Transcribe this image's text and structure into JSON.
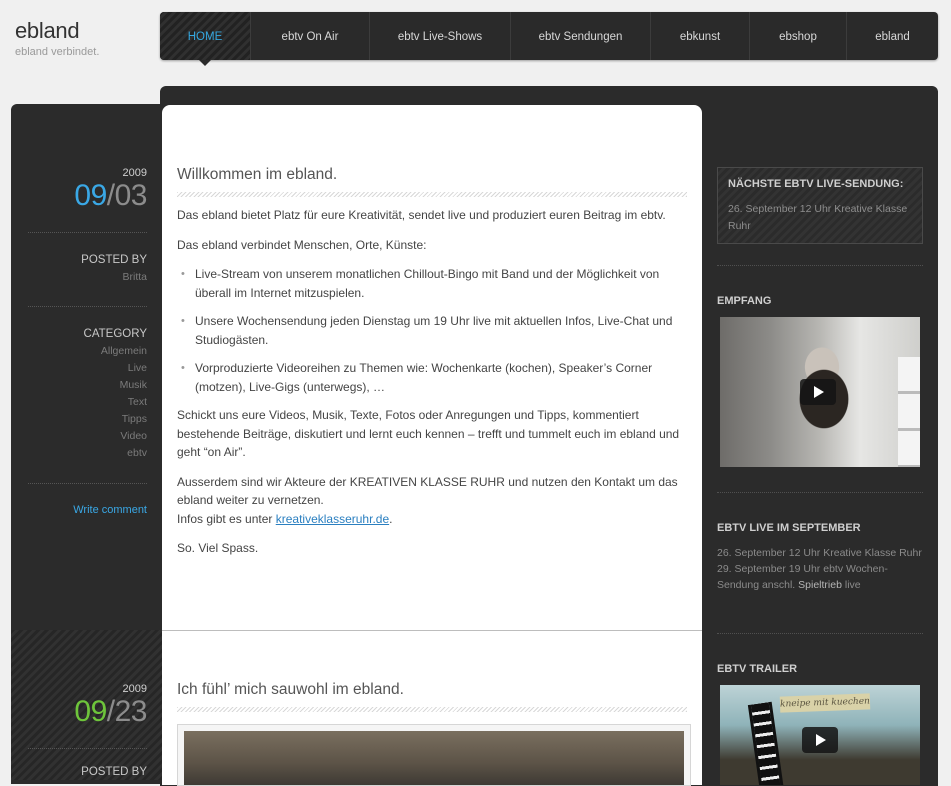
{
  "site": {
    "title": "ebland",
    "tagline": "ebland verbindet."
  },
  "nav": {
    "items": [
      {
        "label": "HOME",
        "active": true
      },
      {
        "label": "ebtv On Air"
      },
      {
        "label": "ebtv Live-Shows"
      },
      {
        "label": "ebtv Sendungen"
      },
      {
        "label": "ebkunst"
      },
      {
        "label": "ebshop"
      },
      {
        "label": "ebland"
      }
    ]
  },
  "posts": [
    {
      "year": "2009",
      "month": "09",
      "day": "03",
      "posted_by_label": "POSTED BY",
      "author": "Britta",
      "category_label": "CATEGORY",
      "categories": [
        "Allgemein",
        "Live",
        "Musik",
        "Text",
        "Tipps",
        "Video",
        "ebtv"
      ],
      "write_comment": "Write comment",
      "title": "Willkommen im ebland.",
      "paragraphs": [
        "Das ebland bietet Platz für eure Kreativität, sendet live und produziert euren Beitrag im ebtv.",
        "Das ebland verbindet Menschen, Orte, Künste:"
      ],
      "bullets": [
        "Live-Stream von unserem monatlichen Chillout-Bingo mit Band und der Möglichkeit von überall im Internet mitzuspielen.",
        "Unsere Wochensendung jeden Dienstag um 19 Uhr live mit aktuellen Infos, Live-Chat und Studiogästen.",
        "Vorproduzierte Videoreihen zu Themen wie: Wochenkarte (kochen), Speaker’s Corner (motzen), Live-Gigs (unterwegs), …"
      ],
      "paragraph_3": "Schickt uns eure Videos, Musik, Texte, Fotos oder Anregungen und Tipps, kommentiert bestehende Beiträge, diskutiert und lernt euch kennen – trefft und tummelt euch im ebland und geht “on Air”.",
      "paragraph_4": "Ausserdem sind wir Akteure der KREATIVEN KLASSE RUHR und nutzen den Kontakt um das ebland weiter zu vernetzen.",
      "info_prefix": "Infos gibt es unter ",
      "info_link": "kreativeklasseruhr.de",
      "info_suffix": ".",
      "closing": "So. Viel Spass."
    },
    {
      "year": "2009",
      "month": "09",
      "day": "23",
      "posted_by_label": "POSTED BY",
      "title": "Ich fühl’ mich sauwohl im ebland."
    }
  ],
  "sidebar": {
    "next_live": {
      "title": "NÄCHSTE EBTV LIVE-SENDUNG:",
      "text": "26. September 12 Uhr Kreative Klasse Ruhr"
    },
    "empfang": {
      "title": "EMPFANG"
    },
    "live_september": {
      "title": "EBTV LIVE IM SEPTEMBER",
      "line1": "26. September 12 Uhr Kreative Klasse Ruhr",
      "line2_prefix": "29. September 19 Uhr ebtv Wochen-Sendung anschl. ",
      "line2_highlight": "Spieltrieb",
      "line2_suffix": " live"
    },
    "trailer": {
      "title": "EBTV TRAILER",
      "note": "kneipe mit kuechen"
    }
  },
  "colors": {
    "accent_blue": "#3aa8e6",
    "accent_green": "#6ec53b",
    "dark": "#2b2b2b"
  }
}
